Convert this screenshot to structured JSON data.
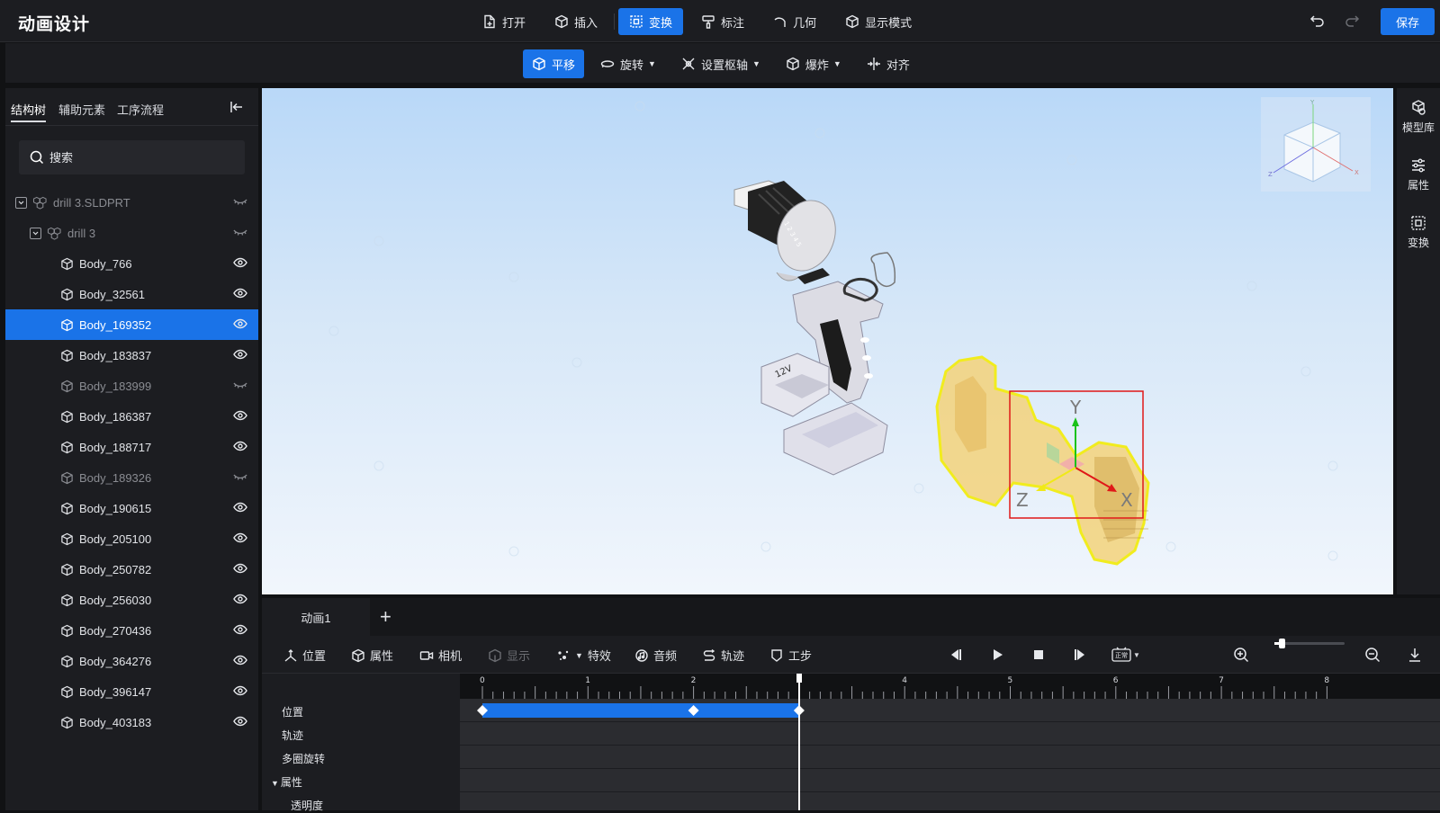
{
  "app": {
    "title": "动画设计"
  },
  "toolbar": {
    "items": [
      {
        "label": "打开",
        "icon": "open-file-icon"
      },
      {
        "label": "插入",
        "icon": "cube-insert-icon"
      },
      {
        "label": "变换",
        "icon": "transform-icon",
        "active": true
      },
      {
        "label": "标注",
        "icon": "brush-icon"
      },
      {
        "label": "几何",
        "icon": "arc-icon"
      },
      {
        "label": "显示模式",
        "icon": "display-mode-icon"
      }
    ],
    "save_label": "保存"
  },
  "subtoolbar": {
    "items": [
      {
        "label": "平移",
        "icon": "translate-icon",
        "active": true,
        "caret": false
      },
      {
        "label": "旋转",
        "icon": "rotate-icon",
        "caret": true
      },
      {
        "label": "设置枢轴",
        "icon": "pivot-icon",
        "caret": true
      },
      {
        "label": "爆炸",
        "icon": "explode-icon",
        "caret": true
      },
      {
        "label": "对齐",
        "icon": "align-icon",
        "caret": false
      }
    ]
  },
  "leftpanel": {
    "tabs": [
      "结构树",
      "辅助元素",
      "工序流程"
    ],
    "search_placeholder": "搜索",
    "tree": [
      {
        "label": "drill 3.SLDPRT",
        "level": 0,
        "toggle": true,
        "dim": true,
        "visible": false
      },
      {
        "label": "drill 3",
        "level": 1,
        "toggle": true,
        "dim": true,
        "visible": false
      },
      {
        "label": "Body_766",
        "level": 2,
        "visible": true
      },
      {
        "label": "Body_32561",
        "level": 2,
        "visible": true
      },
      {
        "label": "Body_169352",
        "level": 2,
        "visible": true,
        "selected": true
      },
      {
        "label": "Body_183837",
        "level": 2,
        "visible": true
      },
      {
        "label": "Body_183999",
        "level": 2,
        "visible": false,
        "dim": true
      },
      {
        "label": "Body_186387",
        "level": 2,
        "visible": true
      },
      {
        "label": "Body_188717",
        "level": 2,
        "visible": true
      },
      {
        "label": "Body_189326",
        "level": 2,
        "visible": false,
        "dim": true
      },
      {
        "label": "Body_190615",
        "level": 2,
        "visible": true
      },
      {
        "label": "Body_205100",
        "level": 2,
        "visible": true
      },
      {
        "label": "Body_250782",
        "level": 2,
        "visible": true
      },
      {
        "label": "Body_256030",
        "level": 2,
        "visible": true
      },
      {
        "label": "Body_270436",
        "level": 2,
        "visible": true
      },
      {
        "label": "Body_364276",
        "level": 2,
        "visible": true
      },
      {
        "label": "Body_396147",
        "level": 2,
        "visible": true
      },
      {
        "label": "Body_403183",
        "level": 2,
        "visible": true
      }
    ]
  },
  "viewport": {
    "gizmo": {
      "x": "X",
      "y": "Y",
      "z": "Z"
    },
    "battery_label": "12V"
  },
  "rightrail": {
    "items": [
      {
        "label": "模型库",
        "icon": "model-library-icon"
      },
      {
        "label": "属性",
        "icon": "properties-icon"
      },
      {
        "label": "变换",
        "icon": "transform-icon"
      }
    ]
  },
  "timeline": {
    "tab_label": "动画1",
    "tools": [
      {
        "label": "位置",
        "icon": "position-icon"
      },
      {
        "label": "属性",
        "icon": "cube-icon"
      },
      {
        "label": "相机",
        "icon": "camera-icon"
      },
      {
        "label": "显示",
        "icon": "display-icon",
        "disabled": true
      },
      {
        "label": "特效",
        "icon": "effects-icon",
        "caret": true
      },
      {
        "label": "音频",
        "icon": "audio-icon"
      },
      {
        "label": "轨迹",
        "icon": "trajectory-icon"
      },
      {
        "label": "工步",
        "icon": "step-icon"
      }
    ],
    "playback_speed_label": "正常",
    "zoom_level": 0.1,
    "ruler_ticks": [
      "0",
      "1",
      "2",
      "3",
      "4",
      "5",
      "6",
      "7",
      "8"
    ],
    "playhead_time": 3,
    "keyframes": [
      0,
      2,
      3
    ],
    "tracks": [
      {
        "label": "位置",
        "indent": false
      },
      {
        "label": "轨迹",
        "indent": false
      },
      {
        "label": "多圈旋转",
        "indent": false
      },
      {
        "label": "属性",
        "indent": false,
        "expanded": true
      },
      {
        "label": "透明度",
        "indent": true
      }
    ],
    "colors": {
      "accent": "#1a73e8"
    }
  }
}
